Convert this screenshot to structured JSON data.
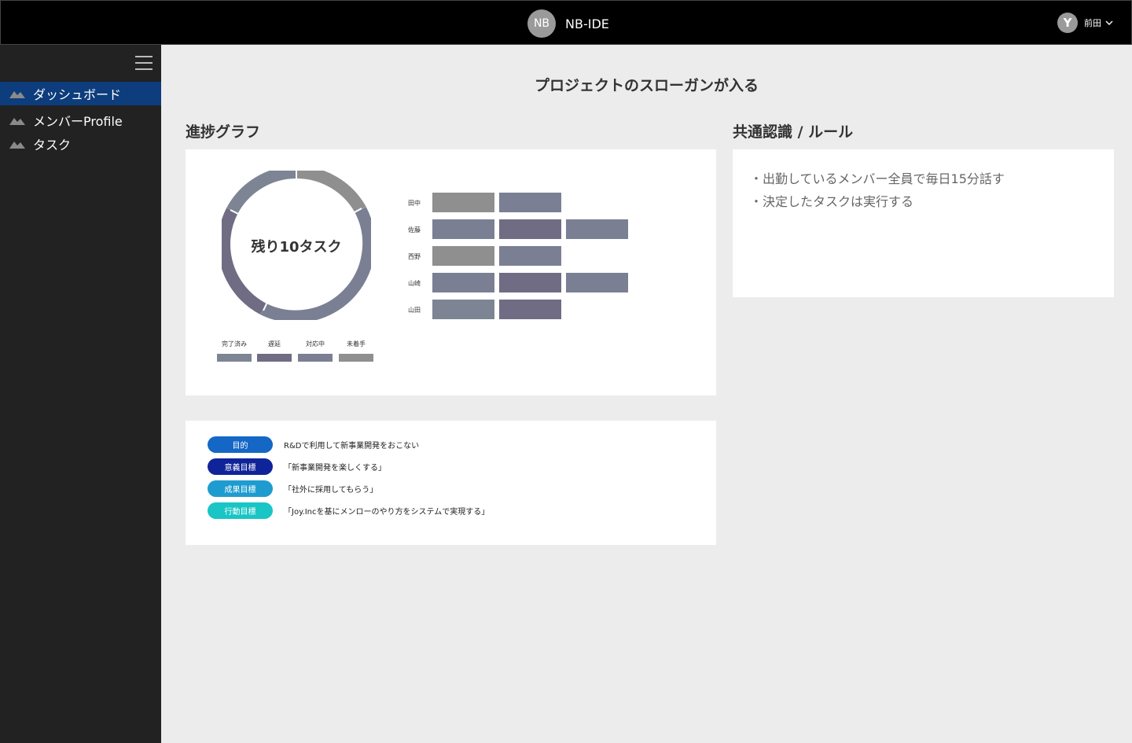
{
  "header": {
    "logo": "NB",
    "app_name": "NB-IDE",
    "user_initial": "Y",
    "user_name": "前田"
  },
  "sidebar": {
    "items": [
      {
        "label": "ダッシュボード",
        "active": true
      },
      {
        "label": "メンバーProfile",
        "active": false
      },
      {
        "label": "タスク",
        "active": false
      }
    ]
  },
  "slogan": "プロジェクトのスローガンが入る",
  "progress": {
    "title": "進捗グラフ",
    "donut_label": "残り10タスク",
    "legend": [
      {
        "label": "完了済み",
        "color": "#7d8594"
      },
      {
        "label": "遅延",
        "color": "#6f6c84"
      },
      {
        "label": "対応中",
        "color": "#7b7f93"
      },
      {
        "label": "未着手",
        "color": "#8f8f8f"
      }
    ],
    "members": [
      {
        "name": "田中",
        "tasks": [
          "未着手",
          "対応中"
        ]
      },
      {
        "name": "佐藤",
        "tasks": [
          "対応中",
          "遅延",
          "対応中"
        ]
      },
      {
        "name": "西野",
        "tasks": [
          "未着手",
          "対応中"
        ]
      },
      {
        "name": "山崎",
        "tasks": [
          "対応中",
          "遅延",
          "対応中"
        ]
      },
      {
        "name": "山田",
        "tasks": [
          "完了済み",
          "遅延"
        ]
      }
    ]
  },
  "goals": [
    {
      "badge": "目的",
      "color": "#1567c6",
      "text": "R&Dで利用して新事業開発をおこない"
    },
    {
      "badge": "意義目標",
      "color": "#10249a",
      "text": "「新事業開発を楽しくする」"
    },
    {
      "badge": "成果目標",
      "color": "#1e9cd0",
      "text": "「社外に採用してもらう」"
    },
    {
      "badge": "行動目標",
      "color": "#19c5c5",
      "text": "「Joy.Incを基にメンローのやり方をシステムで実現する」"
    }
  ],
  "rules": {
    "title": "共通認識 / ルール",
    "items": [
      "・出勤しているメンバー全員で毎日15分話す",
      "・決定したタスクは実行する"
    ]
  },
  "colors": {
    "header_bg": "#000000",
    "sidebar_bg": "#222222",
    "sidebar_active": "#0d3d7c",
    "page_bg": "#ececec"
  },
  "icons": {
    "nav": "mountain-icon",
    "menu": "hamburger-icon",
    "user_menu": "chevron-down-icon"
  }
}
